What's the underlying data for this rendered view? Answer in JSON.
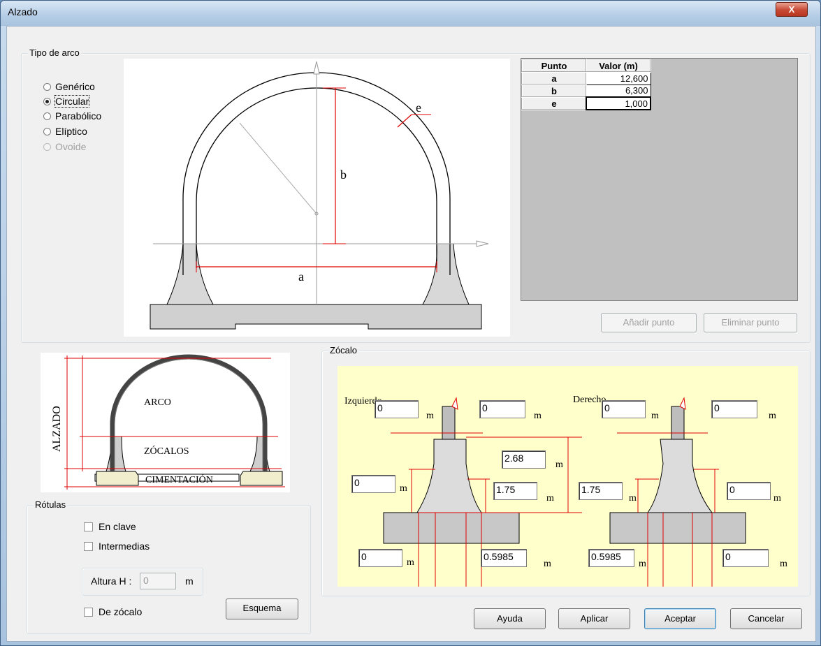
{
  "window": {
    "title": "Alzado",
    "close_glyph": "X"
  },
  "tipo_arco": {
    "group_label": "Tipo de arco",
    "options": [
      {
        "label": "Genérico",
        "selected": false,
        "enabled": true
      },
      {
        "label": "Circular",
        "selected": true,
        "enabled": true
      },
      {
        "label": "Parabólico",
        "selected": false,
        "enabled": true
      },
      {
        "label": "Elíptico",
        "selected": false,
        "enabled": true
      },
      {
        "label": "Ovoide",
        "selected": false,
        "enabled": false
      }
    ],
    "diagram_labels": {
      "a": "a",
      "b": "b",
      "e": "e"
    }
  },
  "grid": {
    "headers": [
      "Punto",
      "Valor (m)"
    ],
    "rows": [
      {
        "punto": "a",
        "valor": "12,600"
      },
      {
        "punto": "b",
        "valor": "6,300"
      },
      {
        "punto": "e",
        "valor": "1,000"
      }
    ],
    "add_button": "Añadir punto",
    "delete_button": "Eliminar punto"
  },
  "scheme": {
    "alzado": "ALZADO",
    "arco": "ARCO",
    "zocalos": "ZÓCALOS",
    "cimentacion": "CIMENTACIÓN"
  },
  "rotulas": {
    "group_label": "Rótulas",
    "en_clave": "En clave",
    "intermedias": "Intermedias",
    "altura_label": "Altura H :",
    "altura_value": "0",
    "altura_unit": "m",
    "de_zocalo": "De zócalo",
    "esquema_button": "Esquema"
  },
  "zocalo": {
    "group_label": "Zócalo",
    "izquierdo": "Izquierdo",
    "derecho": "Derecho",
    "unit": "m",
    "left": {
      "top_left": "0",
      "top_right": "0",
      "height_total": "2.68",
      "side": "0",
      "inner": "1.75",
      "bottom_left": "0",
      "bottom_right": "0.5985"
    },
    "right": {
      "top_left": "0",
      "top_right": "0",
      "inner": "1.75",
      "side": "0",
      "bottom_left": "0.5985",
      "bottom_right": "0"
    },
    "colors": {
      "background": "#ffffcc",
      "dimension": "#e00000",
      "fill": "#d8d8d8"
    }
  },
  "buttons": {
    "ayuda": "Ayuda",
    "aplicar": "Aplicar",
    "aceptar": "Aceptar",
    "cancelar": "Cancelar"
  }
}
